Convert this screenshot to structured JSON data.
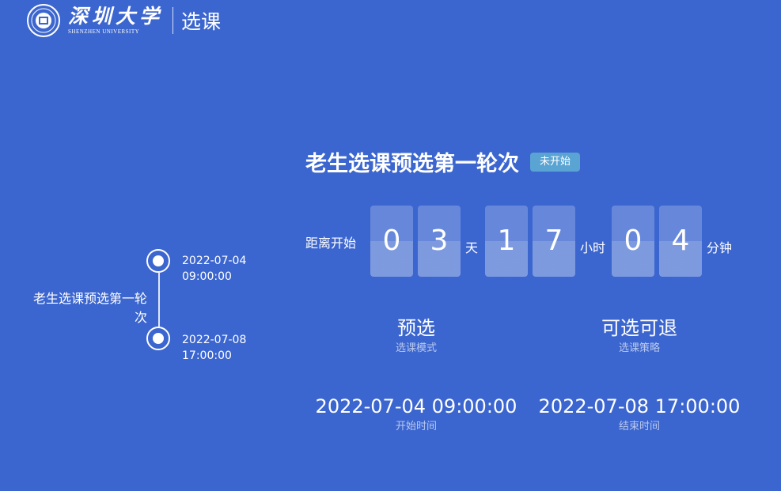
{
  "header": {
    "university_cn": "深圳大学",
    "university_en": "SHENZHEN UNIVERSITY",
    "title": "选课"
  },
  "timeline": {
    "round_name": "老生选课预选第一轮次",
    "start_date": "2022-07-04",
    "start_time": "09:00:00",
    "end_date": "2022-07-08",
    "end_time": "17:00:00"
  },
  "round": {
    "title": "老生选课预选第一轮次",
    "status_badge": "未开始"
  },
  "countdown": {
    "lead_label": "距离开始",
    "days_digits": [
      "0",
      "3"
    ],
    "days_unit": "天",
    "hours_digits": [
      "1",
      "7"
    ],
    "hours_unit": "小时",
    "minutes_digits": [
      "0",
      "4"
    ],
    "minutes_unit": "分钟"
  },
  "info": {
    "mode_value": "预选",
    "mode_label": "选课模式",
    "strategy_value": "可选可退",
    "strategy_label": "选课策略",
    "start_value": "2022-07-04 09:00:00",
    "start_label": "开始时间",
    "end_value": "2022-07-08 17:00:00",
    "end_label": "结束时间"
  },
  "colors": {
    "background": "#3c66cf",
    "badge": "#5aa4d3",
    "sublabel": "#b8c9f0"
  }
}
